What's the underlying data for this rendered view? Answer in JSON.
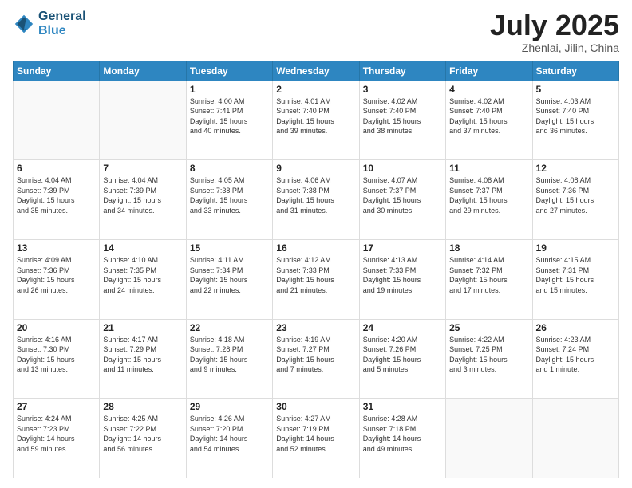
{
  "header": {
    "logo_general": "General",
    "logo_blue": "Blue",
    "month": "July 2025",
    "location": "Zhenlai, Jilin, China"
  },
  "days_of_week": [
    "Sunday",
    "Monday",
    "Tuesday",
    "Wednesday",
    "Thursday",
    "Friday",
    "Saturday"
  ],
  "weeks": [
    [
      {
        "day": "",
        "info": ""
      },
      {
        "day": "",
        "info": ""
      },
      {
        "day": "1",
        "info": "Sunrise: 4:00 AM\nSunset: 7:41 PM\nDaylight: 15 hours\nand 40 minutes."
      },
      {
        "day": "2",
        "info": "Sunrise: 4:01 AM\nSunset: 7:40 PM\nDaylight: 15 hours\nand 39 minutes."
      },
      {
        "day": "3",
        "info": "Sunrise: 4:02 AM\nSunset: 7:40 PM\nDaylight: 15 hours\nand 38 minutes."
      },
      {
        "day": "4",
        "info": "Sunrise: 4:02 AM\nSunset: 7:40 PM\nDaylight: 15 hours\nand 37 minutes."
      },
      {
        "day": "5",
        "info": "Sunrise: 4:03 AM\nSunset: 7:40 PM\nDaylight: 15 hours\nand 36 minutes."
      }
    ],
    [
      {
        "day": "6",
        "info": "Sunrise: 4:04 AM\nSunset: 7:39 PM\nDaylight: 15 hours\nand 35 minutes."
      },
      {
        "day": "7",
        "info": "Sunrise: 4:04 AM\nSunset: 7:39 PM\nDaylight: 15 hours\nand 34 minutes."
      },
      {
        "day": "8",
        "info": "Sunrise: 4:05 AM\nSunset: 7:38 PM\nDaylight: 15 hours\nand 33 minutes."
      },
      {
        "day": "9",
        "info": "Sunrise: 4:06 AM\nSunset: 7:38 PM\nDaylight: 15 hours\nand 31 minutes."
      },
      {
        "day": "10",
        "info": "Sunrise: 4:07 AM\nSunset: 7:37 PM\nDaylight: 15 hours\nand 30 minutes."
      },
      {
        "day": "11",
        "info": "Sunrise: 4:08 AM\nSunset: 7:37 PM\nDaylight: 15 hours\nand 29 minutes."
      },
      {
        "day": "12",
        "info": "Sunrise: 4:08 AM\nSunset: 7:36 PM\nDaylight: 15 hours\nand 27 minutes."
      }
    ],
    [
      {
        "day": "13",
        "info": "Sunrise: 4:09 AM\nSunset: 7:36 PM\nDaylight: 15 hours\nand 26 minutes."
      },
      {
        "day": "14",
        "info": "Sunrise: 4:10 AM\nSunset: 7:35 PM\nDaylight: 15 hours\nand 24 minutes."
      },
      {
        "day": "15",
        "info": "Sunrise: 4:11 AM\nSunset: 7:34 PM\nDaylight: 15 hours\nand 22 minutes."
      },
      {
        "day": "16",
        "info": "Sunrise: 4:12 AM\nSunset: 7:33 PM\nDaylight: 15 hours\nand 21 minutes."
      },
      {
        "day": "17",
        "info": "Sunrise: 4:13 AM\nSunset: 7:33 PM\nDaylight: 15 hours\nand 19 minutes."
      },
      {
        "day": "18",
        "info": "Sunrise: 4:14 AM\nSunset: 7:32 PM\nDaylight: 15 hours\nand 17 minutes."
      },
      {
        "day": "19",
        "info": "Sunrise: 4:15 AM\nSunset: 7:31 PM\nDaylight: 15 hours\nand 15 minutes."
      }
    ],
    [
      {
        "day": "20",
        "info": "Sunrise: 4:16 AM\nSunset: 7:30 PM\nDaylight: 15 hours\nand 13 minutes."
      },
      {
        "day": "21",
        "info": "Sunrise: 4:17 AM\nSunset: 7:29 PM\nDaylight: 15 hours\nand 11 minutes."
      },
      {
        "day": "22",
        "info": "Sunrise: 4:18 AM\nSunset: 7:28 PM\nDaylight: 15 hours\nand 9 minutes."
      },
      {
        "day": "23",
        "info": "Sunrise: 4:19 AM\nSunset: 7:27 PM\nDaylight: 15 hours\nand 7 minutes."
      },
      {
        "day": "24",
        "info": "Sunrise: 4:20 AM\nSunset: 7:26 PM\nDaylight: 15 hours\nand 5 minutes."
      },
      {
        "day": "25",
        "info": "Sunrise: 4:22 AM\nSunset: 7:25 PM\nDaylight: 15 hours\nand 3 minutes."
      },
      {
        "day": "26",
        "info": "Sunrise: 4:23 AM\nSunset: 7:24 PM\nDaylight: 15 hours\nand 1 minute."
      }
    ],
    [
      {
        "day": "27",
        "info": "Sunrise: 4:24 AM\nSunset: 7:23 PM\nDaylight: 14 hours\nand 59 minutes."
      },
      {
        "day": "28",
        "info": "Sunrise: 4:25 AM\nSunset: 7:22 PM\nDaylight: 14 hours\nand 56 minutes."
      },
      {
        "day": "29",
        "info": "Sunrise: 4:26 AM\nSunset: 7:20 PM\nDaylight: 14 hours\nand 54 minutes."
      },
      {
        "day": "30",
        "info": "Sunrise: 4:27 AM\nSunset: 7:19 PM\nDaylight: 14 hours\nand 52 minutes."
      },
      {
        "day": "31",
        "info": "Sunrise: 4:28 AM\nSunset: 7:18 PM\nDaylight: 14 hours\nand 49 minutes."
      },
      {
        "day": "",
        "info": ""
      },
      {
        "day": "",
        "info": ""
      }
    ]
  ]
}
